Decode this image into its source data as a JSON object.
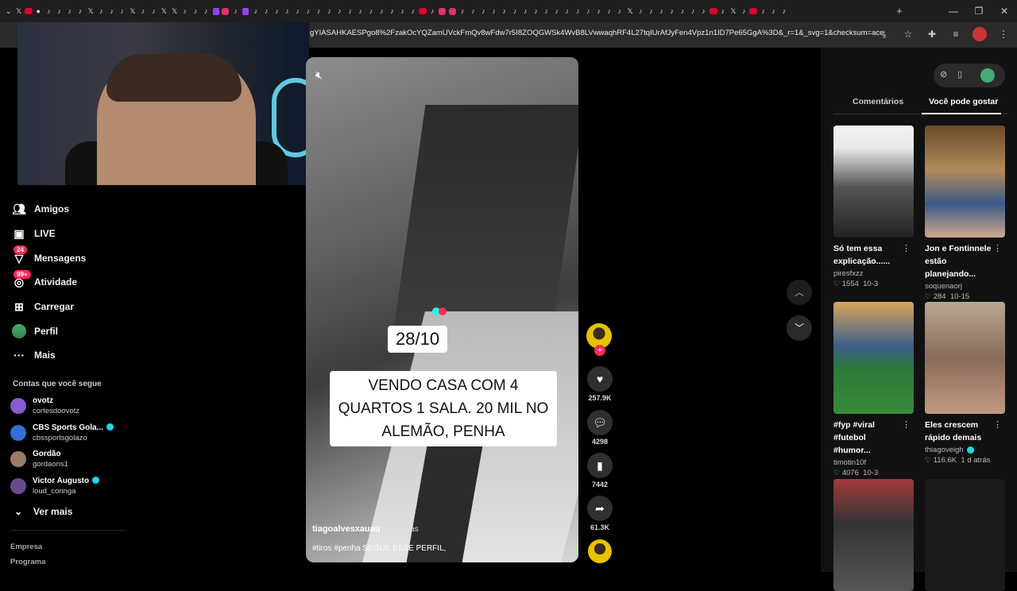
{
  "browser": {
    "url": "gYIASAHKAESPgo8%2FzakOcYQZamUVckFmQv8wFdw7r5I8ZOQGWSk4WvB8LVwwaqhRF4L27tqIUrAfJyFen4Vpz1n1ID7Pe65GgA%3D&_r=1&_svg=1&checksum=ace0f983050..."
  },
  "sidebar": {
    "items": [
      {
        "label": "Amigos",
        "icon": "friends-icon"
      },
      {
        "label": "LIVE",
        "icon": "live-icon"
      },
      {
        "label": "Mensagens",
        "icon": "messages-icon",
        "badge": "24"
      },
      {
        "label": "Atividade",
        "icon": "activity-icon",
        "badge": "99+"
      },
      {
        "label": "Carregar",
        "icon": "upload-icon"
      },
      {
        "label": "Perfil",
        "icon": "profile-icon"
      },
      {
        "label": "Mais",
        "icon": "more-icon"
      }
    ],
    "following_title": "Contas que você segue",
    "following": [
      {
        "name": "ovotz",
        "handle": "cortesdoovotz",
        "verified": false,
        "color": "#8a5ad1"
      },
      {
        "name": "CBS Sports Gola...",
        "handle": "cbssportsgolazo",
        "verified": true,
        "color": "#2f6fd6"
      },
      {
        "name": "Gordão",
        "handle": "gordaons1",
        "verified": false,
        "color": "#9b7a6a"
      },
      {
        "name": "Victor Augusto",
        "handle": "loud_coringa",
        "verified": true,
        "color": "#6a4a8a"
      }
    ],
    "see_more": "Ver mais",
    "footer": [
      "Empresa",
      "Programa"
    ]
  },
  "video": {
    "date_caption": "28/10",
    "main_caption": "VENDO CASA COM 4 QUARTOS 1 SALA. 20 MIL NO ALEMÃO, PENHA",
    "username": "tiagoalvesxauau",
    "time": "· 1 d atrás",
    "description": "#tiros #penha SEGUE ESSE PERFIL,",
    "likes": "257.9K",
    "comments": "4298",
    "saves": "7442",
    "shares": "61.3K"
  },
  "panel": {
    "tab_comments": "Comentários",
    "tab_suggested": "Você pode gostar",
    "cards": [
      {
        "title": "Só tem essa explicação......",
        "user": "piresfxzz",
        "likes": "1554",
        "date": "10-3",
        "verified": false
      },
      {
        "title": "Jon e Fontinnele estão planejando...",
        "user": "soquenaorj",
        "likes": "284",
        "date": "10-15",
        "verified": false
      },
      {
        "title": "#fyp #viral #futebol #humor...",
        "user": "timotin10f",
        "likes": "4076",
        "date": "10-3",
        "verified": false
      },
      {
        "title": "Eles crescem rápido demais",
        "user": "thiagoveigh",
        "likes": "116.6K",
        "date": "1 d atrás",
        "verified": true
      }
    ]
  }
}
